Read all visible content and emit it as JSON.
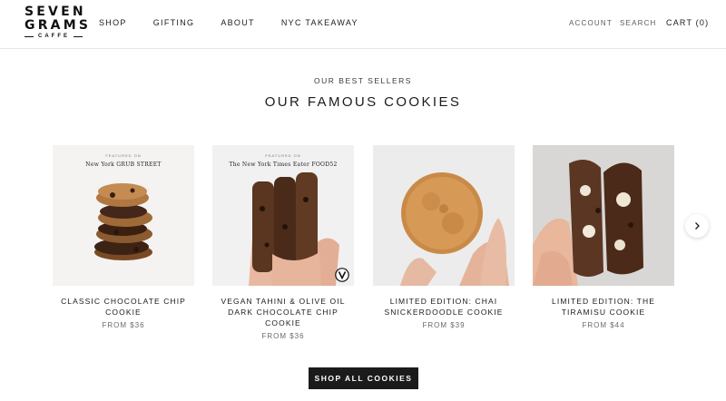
{
  "brand": {
    "line1": "SEVEN",
    "line2": "GRAMS",
    "line3": "CAFFE"
  },
  "nav": {
    "items": [
      {
        "label": "SHOP"
      },
      {
        "label": "GIFTING"
      },
      {
        "label": "ABOUT"
      },
      {
        "label": "NYC TAKEAWAY"
      }
    ]
  },
  "utility": {
    "account": "ACCOUNT",
    "search": "SEARCH",
    "cart": "CART (0)"
  },
  "section": {
    "eyebrow": "OUR BEST SELLERS",
    "title": "OUR FAMOUS COOKIES"
  },
  "products": [
    {
      "name": "CLASSIC CHOCOLATE CHIP COOKIE",
      "price": "FROM $36",
      "press_label": "FEATURED ON",
      "press_logos": "New York   GRUB STREET"
    },
    {
      "name": "VEGAN TAHINI & OLIVE OIL DARK CHOCOLATE CHIP COOKIE",
      "price": "FROM $36",
      "press_label": "FEATURED ON",
      "press_logos": "The New York Times   Eater   FOOD52"
    },
    {
      "name": "LIMITED EDITION: CHAI SNICKERDOODLE COOKIE",
      "price": "FROM $39"
    },
    {
      "name": "LIMITED EDITION: THE TIRAMISU COOKIE",
      "price": "FROM $44"
    }
  ],
  "cta": {
    "label": "SHOP ALL COOKIES"
  },
  "icons": {
    "next": "chevron-right-icon",
    "vegan": "vegan-badge-icon"
  },
  "colors": {
    "text": "#1c1b1b",
    "muted": "#6a6a6a",
    "button_bg": "#1c1b1b",
    "button_text": "#ffffff"
  }
}
